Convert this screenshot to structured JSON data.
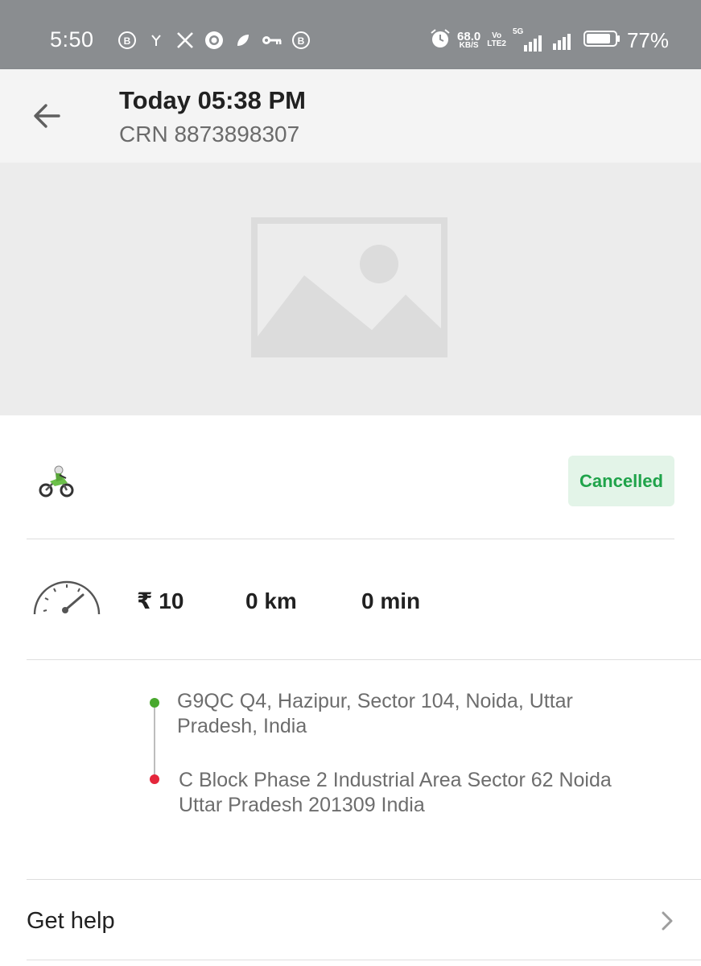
{
  "status_bar": {
    "time": "5:50",
    "speed_value": "68.0",
    "speed_unit": "KB/S",
    "volte_top": "Vo",
    "volte_bottom": "LTE2",
    "network": "5G",
    "battery_percent": "77%",
    "icons": [
      "b-circle-icon",
      "notification-icon",
      "x-icon",
      "circle-app-icon",
      "leaf-icon",
      "key-icon",
      "b-circle-icon",
      "alarm-icon",
      "signal-icon",
      "battery-icon"
    ]
  },
  "header": {
    "title": "Today 05:38 PM",
    "subtitle": "CRN 8873898307",
    "back_icon": "arrow-left-icon"
  },
  "map": {
    "placeholder_icon": "image-placeholder-icon"
  },
  "ride": {
    "vehicle_icon": "motorbike-icon",
    "status": "Cancelled",
    "status_color": "#1fa34a",
    "status_bg": "#e3f4e8"
  },
  "stats": {
    "fare": "₹ 10",
    "distance": "0 km",
    "duration": "0 min"
  },
  "route": {
    "pickup_line1": "G9QC Q4, Hazipur, Sector 104, Noida, Uttar",
    "pickup_line2": "Pradesh, India",
    "drop_line1": "C Block Phase 2 Industrial Area Sector 62 Noida",
    "drop_line2": "Uttar Pradesh 201309 India",
    "pickup_color": "#49a82e",
    "drop_color": "#e4263b"
  },
  "help": {
    "label": "Get help"
  }
}
